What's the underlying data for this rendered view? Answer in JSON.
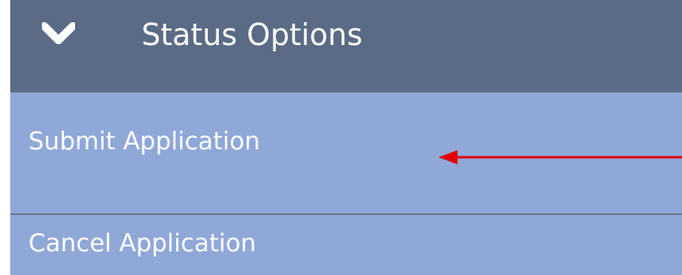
{
  "header": {
    "title": "Status Options",
    "icon": "chevron-down-icon",
    "background": "#5b6b86",
    "text_color": "#ffffff"
  },
  "options": {
    "background": "#8fa8d8",
    "items": [
      {
        "label": "Submit Application"
      },
      {
        "label": "Cancel Application"
      }
    ]
  },
  "annotation": {
    "arrow_color": "#e00000",
    "icon": "red-arrow-left-icon"
  }
}
